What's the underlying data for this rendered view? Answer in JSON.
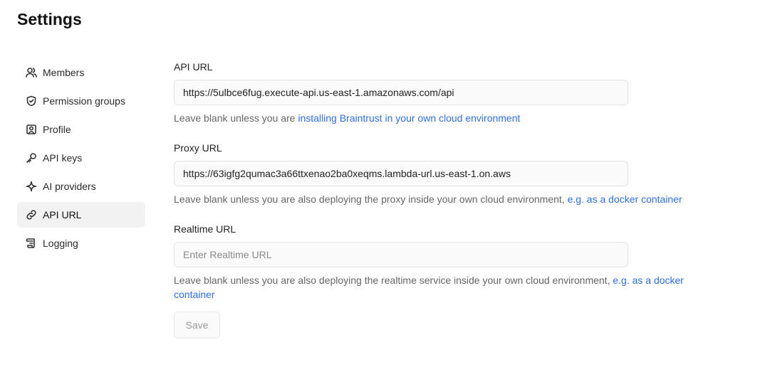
{
  "header": {
    "title": "Settings"
  },
  "sidebar": {
    "items": [
      {
        "label": "Members",
        "icon": "users-icon"
      },
      {
        "label": "Permission groups",
        "icon": "shield-check-icon"
      },
      {
        "label": "Profile",
        "icon": "profile-icon"
      },
      {
        "label": "API keys",
        "icon": "key-icon"
      },
      {
        "label": "AI providers",
        "icon": "sparkle-icon"
      },
      {
        "label": "API URL",
        "icon": "link-icon",
        "active": true
      },
      {
        "label": "Logging",
        "icon": "scroll-icon"
      }
    ]
  },
  "form": {
    "api_url": {
      "label": "API URL",
      "value": "https://5ulbce6fug.execute-api.us-east-1.amazonaws.com/api",
      "help": "Leave blank unless you are ",
      "link": "installing Braintrust in your own cloud environment"
    },
    "proxy_url": {
      "label": "Proxy URL",
      "value": "https://63igfg2qumac3a66ttxenao2ba0xeqms.lambda-url.us-east-1.on.aws",
      "help": "Leave blank unless you are also deploying the proxy inside your own cloud environment, ",
      "link": "e.g. as a docker container"
    },
    "realtime_url": {
      "label": "Realtime URL",
      "value": "",
      "placeholder": "Enter Realtime URL",
      "help": "Leave blank unless you are also deploying the realtime service inside your own cloud environment, ",
      "link": "e.g. as a docker container"
    },
    "save_label": "Save"
  }
}
